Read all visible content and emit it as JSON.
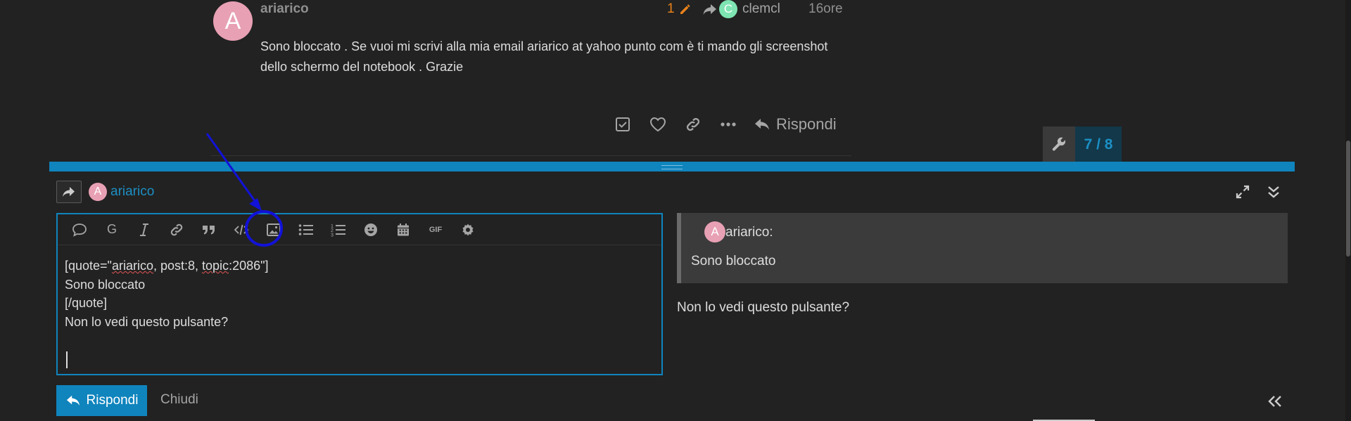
{
  "post": {
    "avatar_letter": "A",
    "avatar_color": "#e8a0b4",
    "username": "ariarico",
    "edit_count": "1",
    "reply_to_avatar_letter": "C",
    "reply_to_avatar_color": "#7ee5b2",
    "reply_to_user": "clemcl",
    "age": "16ore",
    "body": "Sono bloccato . Se vuoi mi scrivi alla mia email ariarico at yahoo punto com è ti mando gli screenshot dello schermo del notebook . Grazie",
    "actions": {
      "reply_label": "Rispondi"
    }
  },
  "timeline": {
    "counter": "7 / 8"
  },
  "composer": {
    "avatar_letter": "A",
    "reply_user": "ariarico",
    "toolbar_icons": [
      "quote-icon",
      "grammar-icon",
      "italic-icon",
      "link-icon",
      "blockquote-icon",
      "code-icon",
      "image-upload-icon",
      "bullet-list-icon",
      "numbered-list-icon",
      "emoji-icon",
      "calendar-icon",
      "gif-icon",
      "gear-icon"
    ],
    "toolbar_text": {
      "grammar": "G",
      "gif": "GIF"
    },
    "editor": {
      "line1_pre": "[quote=\"",
      "line1_user": "ariarico",
      "line1_mid": ", post:8, ",
      "line1_topic": "topic",
      "line1_post": ":2086\"]",
      "line2": "Sono bloccato",
      "line3": "[/quote]",
      "line4": "Non lo vedi questo pulsante?"
    },
    "preview": {
      "quote_avatar_letter": "A",
      "quote_author": "ariarico:",
      "quote_text": "Sono bloccato",
      "text": "Non lo vedi questo pulsante?"
    },
    "submit_label": "Rispondi",
    "close_label": "Chiudi"
  },
  "colors": {
    "background": "#222222",
    "accent": "#0f84bd",
    "link": "#1c8fc4",
    "edit_orange": "#e8821a",
    "annotation": "#1212d8"
  }
}
